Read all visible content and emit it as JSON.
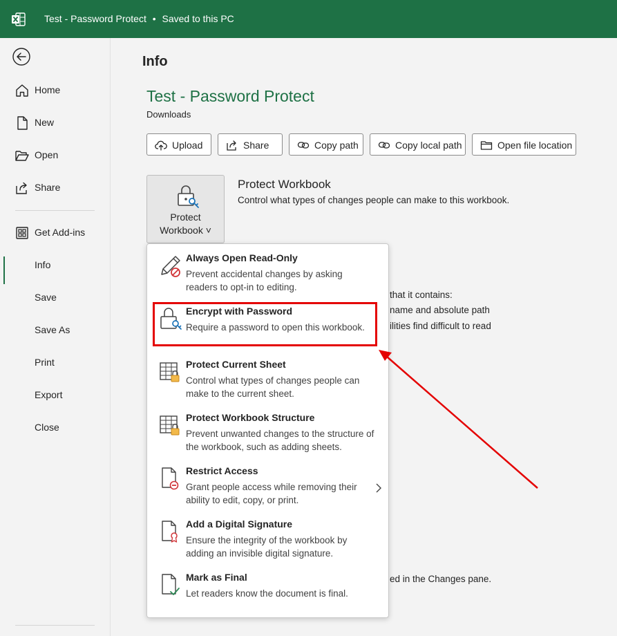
{
  "window": {
    "title": "Test - Password Protect",
    "separator": "•",
    "save_status": "Saved to this PC"
  },
  "sidebar": {
    "items": [
      {
        "label": "Home",
        "icon": "home-icon"
      },
      {
        "label": "New",
        "icon": "new-document-icon"
      },
      {
        "label": "Open",
        "icon": "folder-open-icon"
      },
      {
        "label": "Share",
        "icon": "share-icon"
      },
      {
        "label": "Get Add-ins",
        "icon": "grid-add-icon"
      },
      {
        "label": "Info",
        "active": true
      },
      {
        "label": "Save"
      },
      {
        "label": "Save As"
      },
      {
        "label": "Print"
      },
      {
        "label": "Export"
      },
      {
        "label": "Close"
      }
    ]
  },
  "main": {
    "heading": "Info",
    "document_title": "Test - Password Protect",
    "document_location": "Downloads",
    "actions": [
      {
        "label": "Upload",
        "icon": "upload-cloud-icon"
      },
      {
        "label": "Share",
        "icon": "share-icon"
      },
      {
        "label": "Copy path",
        "icon": "link-icon"
      },
      {
        "label": "Copy local path",
        "icon": "link-icon"
      },
      {
        "label": "Open file location",
        "icon": "folder-icon"
      }
    ],
    "protect": {
      "button_line1": "Protect",
      "button_line2": "Workbook ˅",
      "title": "Protect Workbook",
      "description": "Control what types of changes people can make to this workbook."
    },
    "background_fragments": [
      "that it contains:",
      "name and absolute path",
      "ilities find difficult to read",
      "ed in the Changes pane."
    ]
  },
  "dropdown": {
    "items": [
      {
        "title": "Always Open Read-Only",
        "description": "Prevent accidental changes by asking readers to opt-in to editing.",
        "icon": "pencil-no-icon"
      },
      {
        "title": "Encrypt with Password",
        "description": "Require a password to open this workbook.",
        "icon": "lock-key-icon",
        "highlighted": true
      },
      {
        "title": "Protect Current Sheet",
        "description": "Control what types of changes people can make to the current sheet.",
        "icon": "sheet-lock-icon"
      },
      {
        "title": "Protect Workbook Structure",
        "description": "Prevent unwanted changes to the structure of the workbook, such as adding sheets.",
        "icon": "workbook-lock-icon"
      },
      {
        "title": "Restrict Access",
        "description": "Grant people access while removing their ability to edit, copy, or print.",
        "icon": "document-restrict-icon",
        "has_submenu": true
      },
      {
        "title": "Add a Digital Signature",
        "description": "Ensure the integrity of the workbook by adding an invisible digital signature.",
        "icon": "document-ribbon-icon"
      },
      {
        "title": "Mark as Final",
        "description": "Let readers know the document is final.",
        "icon": "document-check-icon"
      }
    ]
  },
  "annotation": {
    "color": "#e40000"
  },
  "colors": {
    "brand": "#1e7145",
    "background": "#f3f3f3"
  }
}
